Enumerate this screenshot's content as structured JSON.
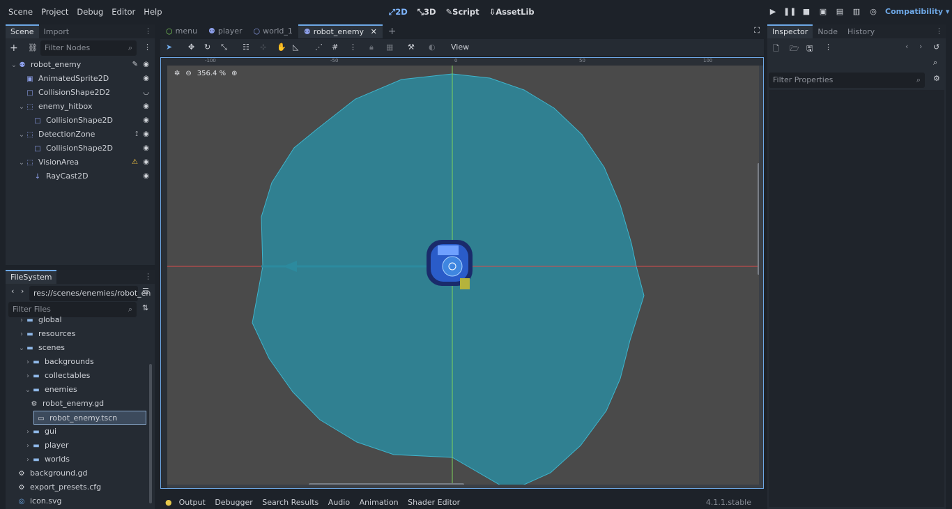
{
  "menu": [
    "Scene",
    "Project",
    "Debug",
    "Editor",
    "Help"
  ],
  "modes": [
    {
      "label": "2D",
      "active": true,
      "icon": "2d-icon"
    },
    {
      "label": "3D",
      "active": false,
      "icon": "3d-icon"
    },
    {
      "label": "Script",
      "active": false,
      "icon": "script-icon"
    },
    {
      "label": "AssetLib",
      "active": false,
      "icon": "assetlib-icon"
    }
  ],
  "renderer": "Compatibility",
  "scene_dock": {
    "tabs": [
      "Scene",
      "Import"
    ],
    "filter_placeholder": "Filter Nodes"
  },
  "nodes": [
    {
      "name": "robot_enemy",
      "depth": 0,
      "icon": "robot-icon",
      "script": true,
      "visible": true
    },
    {
      "name": "AnimatedSprite2D",
      "depth": 1,
      "icon": "sprite-icon",
      "visible": true
    },
    {
      "name": "CollisionShape2D2",
      "depth": 1,
      "icon": "collision-icon",
      "visible": false
    },
    {
      "name": "enemy_hitbox",
      "depth": 1,
      "icon": "area-icon",
      "visible": true,
      "expanded": true
    },
    {
      "name": "CollisionShape2D",
      "depth": 2,
      "icon": "collision-icon",
      "visible": true
    },
    {
      "name": "DetectionZone",
      "depth": 1,
      "icon": "area-icon",
      "visible": true,
      "signal": true,
      "expanded": true
    },
    {
      "name": "CollisionShape2D",
      "depth": 2,
      "icon": "collision-icon",
      "visible": true
    },
    {
      "name": "VisionArea",
      "depth": 1,
      "icon": "area-icon",
      "visible": true,
      "warning": true,
      "expanded": true
    },
    {
      "name": "RayCast2D",
      "depth": 2,
      "icon": "raycast-icon",
      "visible": true
    }
  ],
  "filesystem": {
    "tab": "FileSystem",
    "path": "res://scenes/enemies/robot_en",
    "filter_placeholder": "Filter Files",
    "items": [
      {
        "name": "global",
        "depth": 1,
        "type": "folder"
      },
      {
        "name": "resources",
        "depth": 1,
        "type": "folder"
      },
      {
        "name": "scenes",
        "depth": 1,
        "type": "folder"
      },
      {
        "name": "backgrounds",
        "depth": 2,
        "type": "folder"
      },
      {
        "name": "collectables",
        "depth": 2,
        "type": "folder"
      },
      {
        "name": "enemies",
        "depth": 2,
        "type": "folder"
      },
      {
        "name": "robot_enemy.gd",
        "depth": 3,
        "type": "script",
        "selected": false
      },
      {
        "name": "robot_enemy.tscn",
        "depth": 3,
        "type": "scene",
        "selected": true
      },
      {
        "name": "gui",
        "depth": 2,
        "type": "folder"
      },
      {
        "name": "player",
        "depth": 2,
        "type": "folder"
      },
      {
        "name": "worlds",
        "depth": 2,
        "type": "folder"
      },
      {
        "name": "background.gd",
        "depth": 1,
        "type": "script"
      },
      {
        "name": "export_presets.cfg",
        "depth": 1,
        "type": "config"
      },
      {
        "name": "icon.svg",
        "depth": 1,
        "type": "image"
      }
    ]
  },
  "scene_tabs": [
    {
      "label": "menu",
      "active": false
    },
    {
      "label": "player",
      "active": false
    },
    {
      "label": "world_1",
      "active": false
    },
    {
      "label": "robot_enemy",
      "active": true
    }
  ],
  "toolbar": {
    "view_label": "View"
  },
  "viewport": {
    "zoom": "356.4 %",
    "ruler_labels": [
      "-100",
      "-50",
      "0",
      "50",
      "100"
    ],
    "colors": {
      "bg": "#4a4a4a",
      "shape": "#2c8a9e",
      "axis_x": "#d94c4c",
      "axis_y": "#7fd35a"
    }
  },
  "inspector": {
    "tabs": [
      "Inspector",
      "Node",
      "History"
    ],
    "filter_placeholder": "Filter Properties"
  },
  "bottom": {
    "tabs": [
      "Output",
      "Debugger",
      "Search Results",
      "Audio",
      "Animation",
      "Shader Editor"
    ],
    "version": "4.1.1.stable"
  }
}
